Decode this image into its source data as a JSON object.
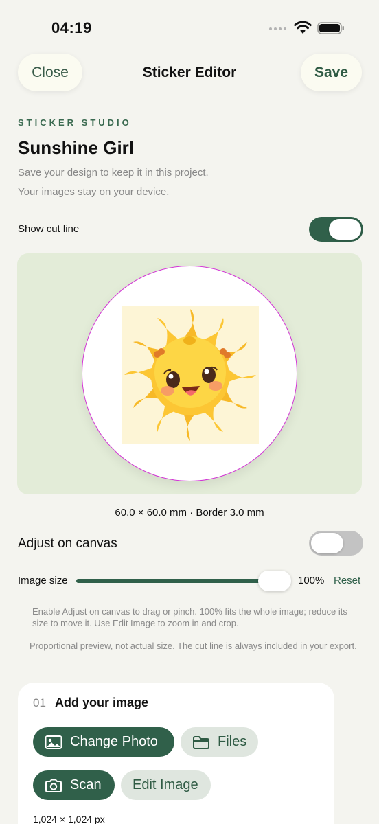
{
  "status_bar": {
    "time": "04:19"
  },
  "nav": {
    "close_label": "Close",
    "title": "Sticker Editor",
    "save_label": "Save"
  },
  "header": {
    "eyebrow": "STICKER STUDIO",
    "title": "Sunshine Girl",
    "subtitle_1": "Save your design to keep it in this project.",
    "subtitle_2": "Your images stay on your device."
  },
  "cut_line": {
    "label": "Show cut line",
    "enabled": true
  },
  "canvas": {
    "dimensions": "60.0 × 60.0 mm  ·  Border 3.0 mm"
  },
  "adjust": {
    "label": "Adjust on canvas",
    "enabled": false
  },
  "image_size": {
    "label": "Image size",
    "value": "100%",
    "level": 1.0,
    "reset_label": "Reset"
  },
  "help": {
    "adjust_hint": "Enable Adjust on canvas to drag or pinch. 100% fits the whole image; reduce its size to move it. Use Edit Image to zoom in and crop.",
    "preview_hint": "Proportional preview, not actual size. The cut line is always included in your export."
  },
  "step": {
    "number": "01",
    "title": "Add your image",
    "buttons": {
      "change_photo": "Change Photo",
      "files": "Files",
      "scan": "Scan",
      "edit_image": "Edit Image"
    },
    "pixel_size": "1,024 × 1,024 px"
  },
  "icons": {
    "wifi": "wifi-icon",
    "battery": "battery-icon",
    "photo": "photo-icon",
    "folder": "folder-icon",
    "camera": "camera-icon"
  },
  "colors": {
    "accent": "#30604a",
    "background": "#f4f4ef",
    "canvas": "#e3ecd8",
    "cut_line": "#d334d6"
  }
}
